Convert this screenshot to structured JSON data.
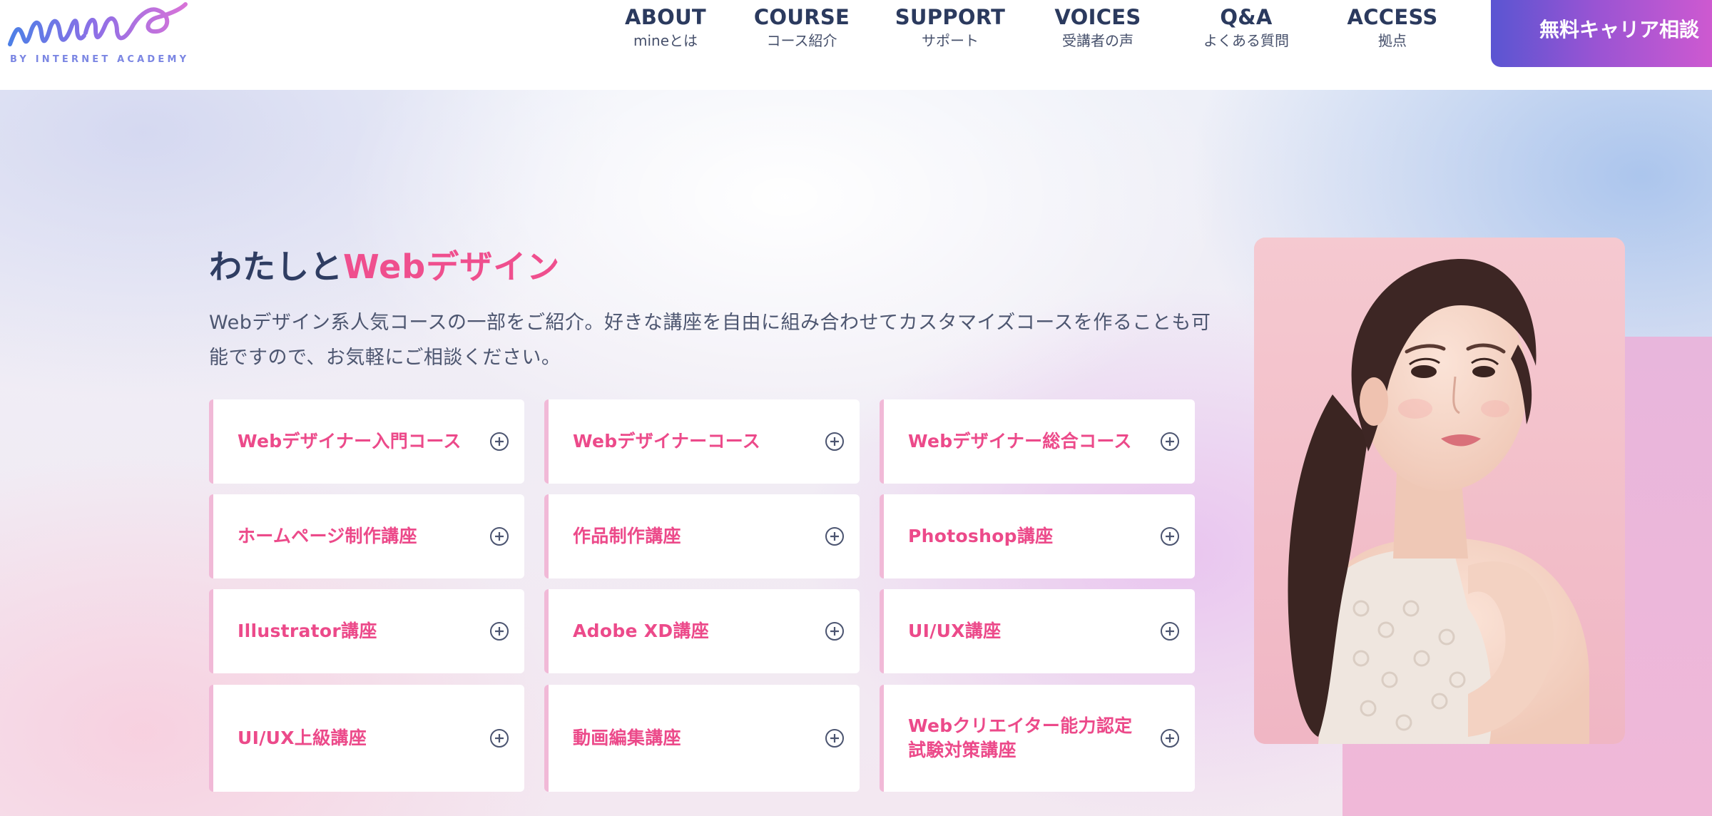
{
  "logo": {
    "wordmark": "mine",
    "sub": "BY INTERNET ACADEMY"
  },
  "nav": [
    {
      "en": "ABOUT",
      "ja": "mineとは"
    },
    {
      "en": "COURSE",
      "ja": "コース紹介"
    },
    {
      "en": "SUPPORT",
      "ja": "サポート"
    },
    {
      "en": "VOICES",
      "ja": "受講者の声"
    },
    {
      "en": "Q&A",
      "ja": "よくある質問"
    },
    {
      "en": "ACCESS",
      "ja": "拠点"
    }
  ],
  "cta": {
    "label": "無料キャリア相談"
  },
  "section": {
    "title_lead": "わたしと",
    "title_accent": "Webデザイン",
    "description": "Webデザイン系人気コースの一部をご紹介。好きな講座を自由に組み合わせてカスタマイズコースを作ることも可能ですので、お気軽にご相談ください。"
  },
  "courses": [
    {
      "label": "Webデザイナー入門コース"
    },
    {
      "label": "Webデザイナーコース"
    },
    {
      "label": "Webデザイナー総合コース"
    },
    {
      "label": "ホームページ制作講座"
    },
    {
      "label": "作品制作講座"
    },
    {
      "label": "Photoshop講座"
    },
    {
      "label": "Illustrator講座"
    },
    {
      "label": "Adobe XD講座"
    },
    {
      "label": "UI/UX講座"
    },
    {
      "label": "UI/UX上級講座"
    },
    {
      "label": "動画編集講座"
    },
    {
      "label": "Webクリエイター能力認定試験対策講座"
    }
  ],
  "icons": {
    "course_expand": "plus-circle-icon"
  },
  "colors": {
    "accent_pink": "#ef4f8e",
    "navy": "#2f3d62",
    "cta_gradient_start": "#5a55d2",
    "cta_gradient_end": "#d45ad0"
  }
}
